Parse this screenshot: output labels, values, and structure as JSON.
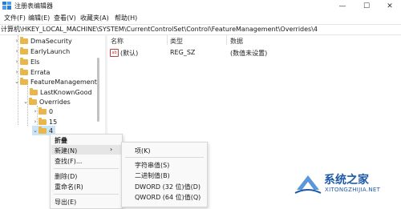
{
  "window": {
    "title": "注册表编辑器",
    "minimize_glyph": "—",
    "maximize_glyph": "☐",
    "close_glyph": "✕"
  },
  "menubar": [
    "文件(F)",
    "编辑(E)",
    "查看(V)",
    "收藏夹(A)",
    "帮助(H)"
  ],
  "address": "计算机\\HKEY_LOCAL_MACHINE\\SYSTEM\\CurrentControlSet\\Control\\FeatureManagement\\Overrides\\4",
  "tree": {
    "items": [
      {
        "label": "DmaSecurity",
        "expander": "›",
        "selected": false
      },
      {
        "label": "EarlyLaunch",
        "expander": "›",
        "selected": false
      },
      {
        "label": "Els",
        "expander": "›",
        "selected": false
      },
      {
        "label": "Errata",
        "expander": "›",
        "selected": false
      },
      {
        "label": "FeatureManagement",
        "expander": "⌄",
        "selected": false
      },
      {
        "label": "LastKnownGood",
        "expander": "",
        "selected": false
      },
      {
        "label": "Overrides",
        "expander": "⌄",
        "selected": false
      },
      {
        "label": "0",
        "expander": "›",
        "selected": false
      },
      {
        "label": "15",
        "expander": "›",
        "selected": false
      },
      {
        "label": "4",
        "expander": "⌄",
        "selected": true
      }
    ]
  },
  "list": {
    "headers": [
      "名称",
      "类型",
      "数据"
    ],
    "rows": [
      {
        "icon": "ab",
        "name": "(默认)",
        "type": "REG_SZ",
        "data": "(数值未设置)"
      }
    ]
  },
  "context_menu": {
    "items": [
      "折叠",
      "新建(N)",
      "查找(F)...",
      "删除(D)",
      "重命名(R)",
      "导出(E)"
    ],
    "submenu_arrow": "›"
  },
  "submenu": {
    "items": [
      "项(K)",
      "字符串值(S)",
      "二进制值(B)",
      "DWORD (32 位)值(D)",
      "QWORD (64 位)值(Q)"
    ]
  },
  "watermark": {
    "title": "系统之家",
    "subtitle": "XITONGZHIJIA.NET"
  },
  "colors": {
    "folder": "#e8b64a",
    "selection": "#cce4f7",
    "menu_highlight": "#e5e5e5",
    "watermark": "#1e5aa8"
  }
}
